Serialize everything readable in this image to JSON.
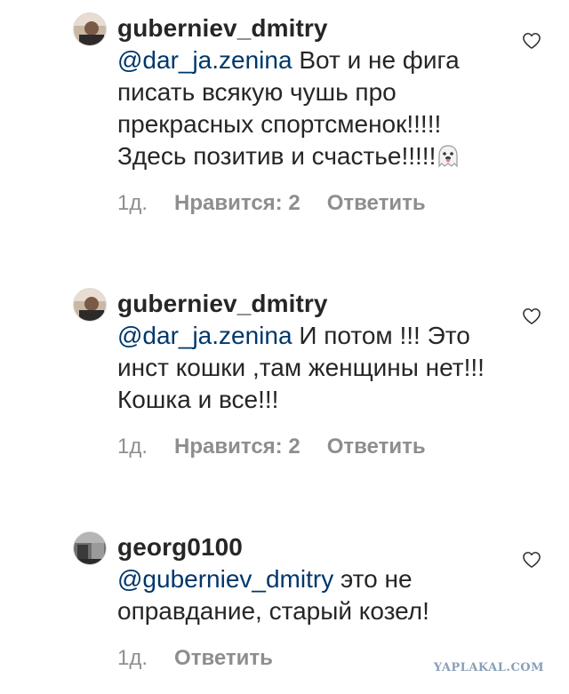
{
  "comments": [
    {
      "username": "guberniev_dmitry",
      "mention": "@dar_ja.zenina",
      "text": " Вот и не фига писать всякую чушь про прекрасных спортсменок!!!!! Здесь позитив и счастье!!!!!",
      "emoji": "ghost-tongue-emoji",
      "time": "1д.",
      "likes": "Нравится: 2",
      "reply": "Ответить",
      "avatar_icon": "user-avatar-photo",
      "heart_icon": "heart-outline-icon"
    },
    {
      "username": "guberniev_dmitry",
      "mention": "@dar_ja.zenina",
      "text": " И потом !!! Это инст кошки ,там женщины нет!!! Кошка и все!!!",
      "time": "1д.",
      "likes": "Нравится: 2",
      "reply": "Ответить",
      "avatar_icon": "user-avatar-photo",
      "heart_icon": "heart-outline-icon"
    },
    {
      "username": "georg0100",
      "mention": "@guberniev_dmitry",
      "text": " это не оправдание, старый козел!",
      "time": "1д.",
      "reply": "Ответить",
      "avatar_icon": "user-avatar-photo",
      "heart_icon": "heart-outline-icon"
    }
  ],
  "watermark": "YAPLAKAL.COM",
  "colors": {
    "text": "#262626",
    "mention": "#00376b",
    "meta": "#8e8e8e"
  }
}
